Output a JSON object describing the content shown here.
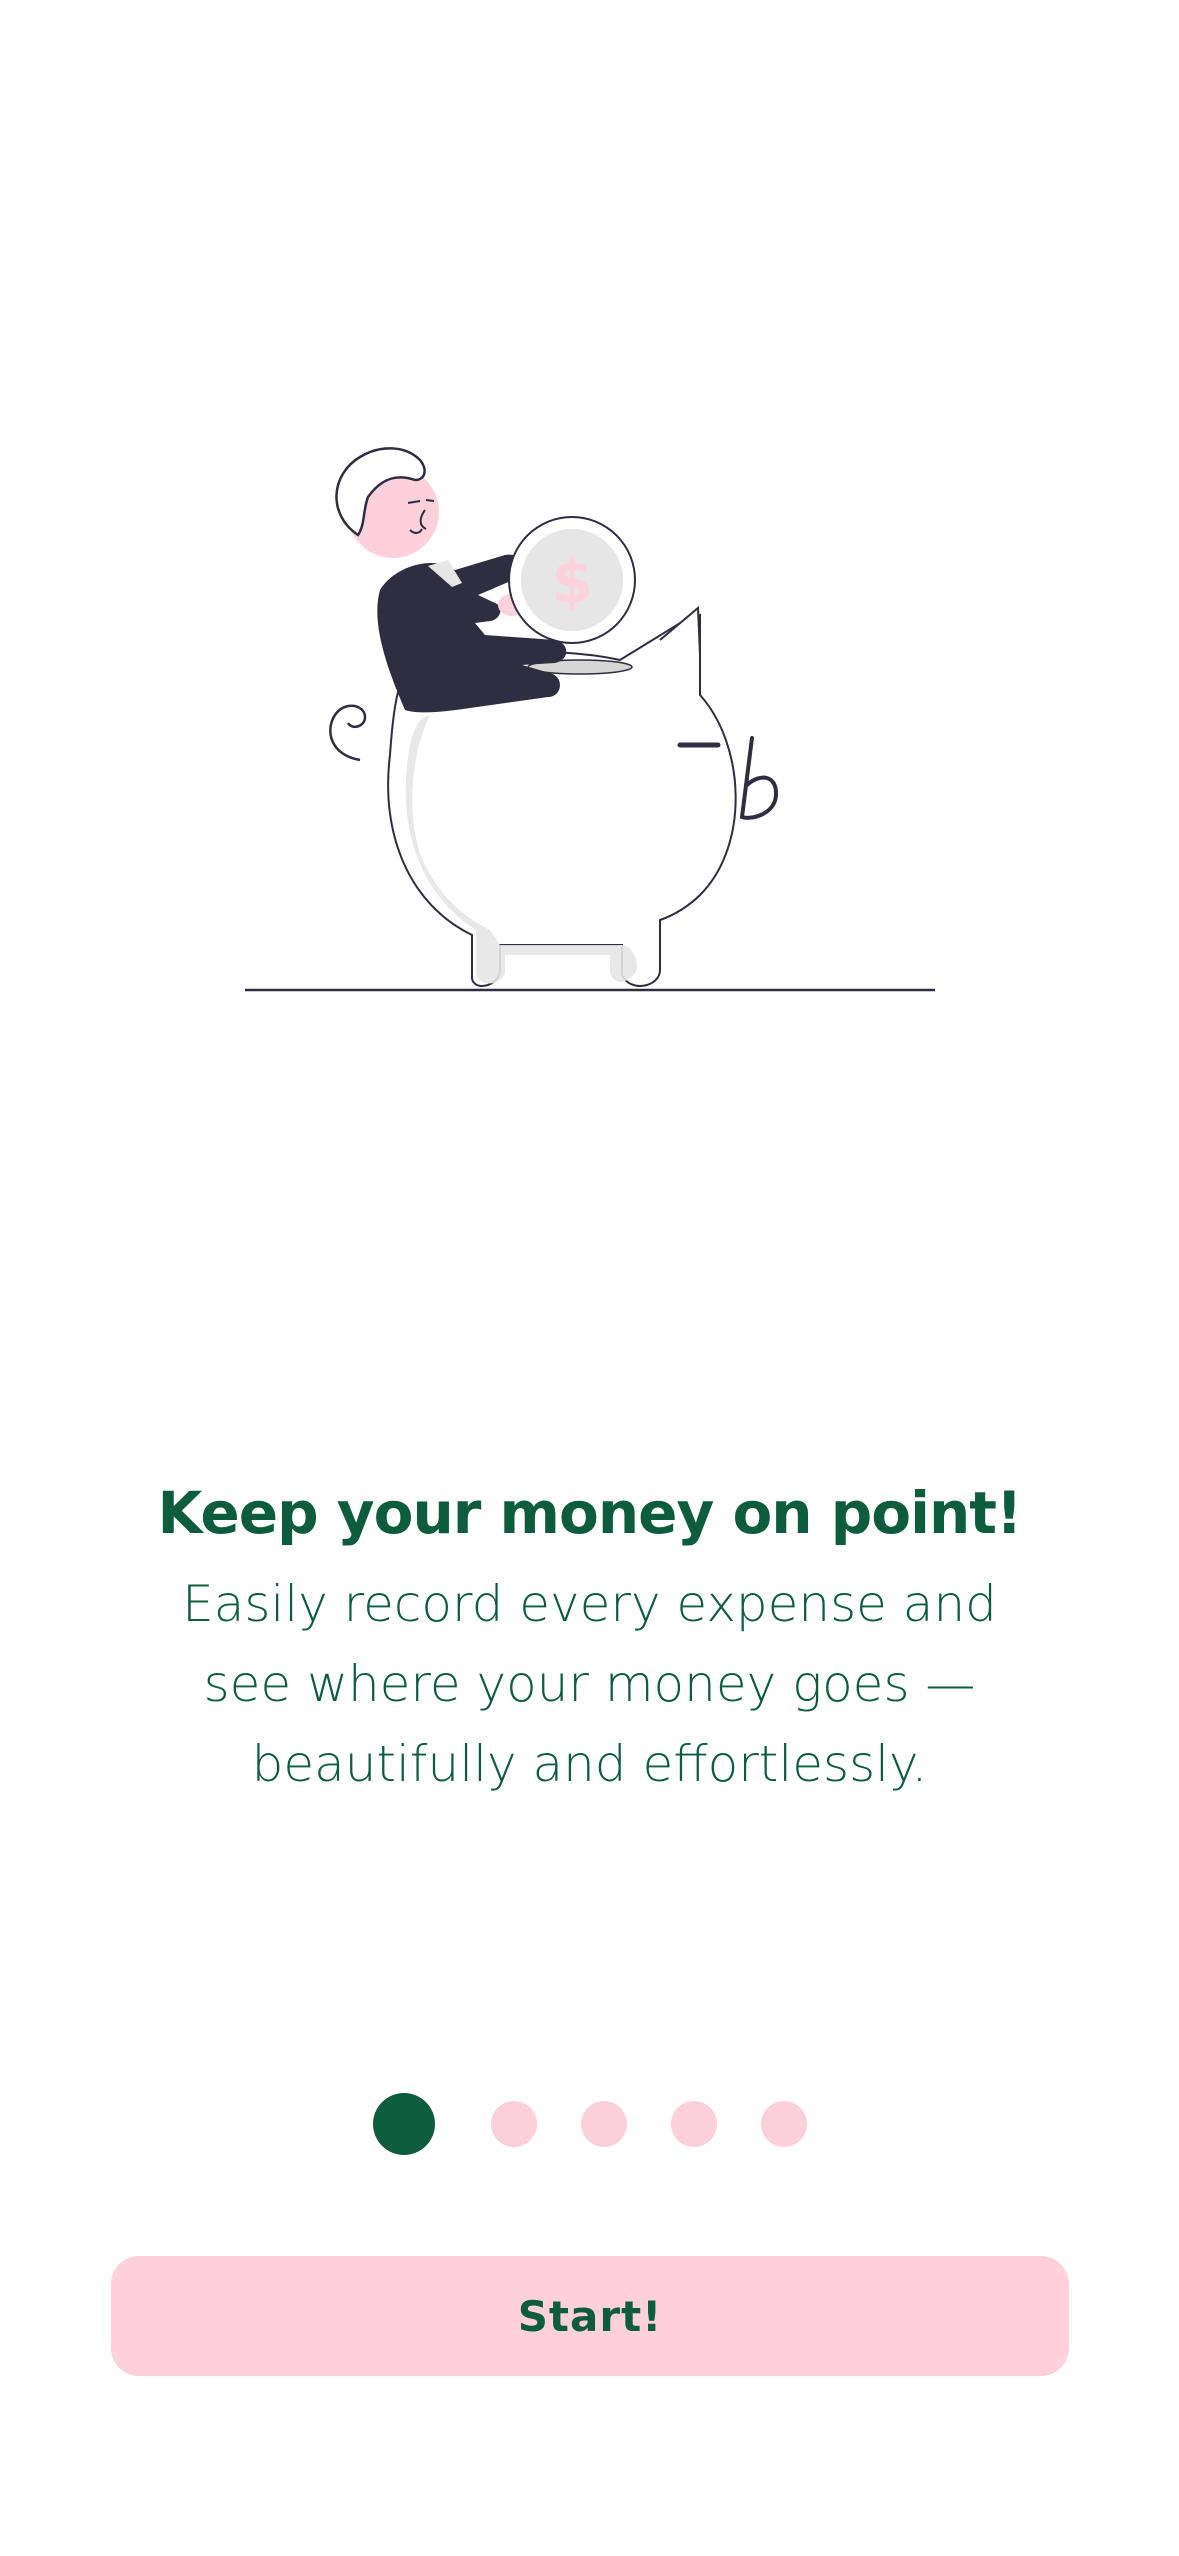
{
  "onboarding": {
    "headline": "Keep your money on point!",
    "subtitle": "Easily record every expense and see where your money goes — beautifully and effortlessly.",
    "pager": {
      "total_pages": 5,
      "current_page": 1
    },
    "start_button_label": "Start!",
    "illustration": {
      "coin_symbol": "$"
    }
  },
  "colors": {
    "brand_green": "#0d5c3e",
    "accent_pink": "#ffd1dc",
    "dot_inactive": "#fbd0da",
    "dark_navy": "#2f2e41",
    "light_gray": "#e6e6e6"
  },
  "icons": {
    "illustration": "man-riding-piggy-bank-illustration"
  }
}
